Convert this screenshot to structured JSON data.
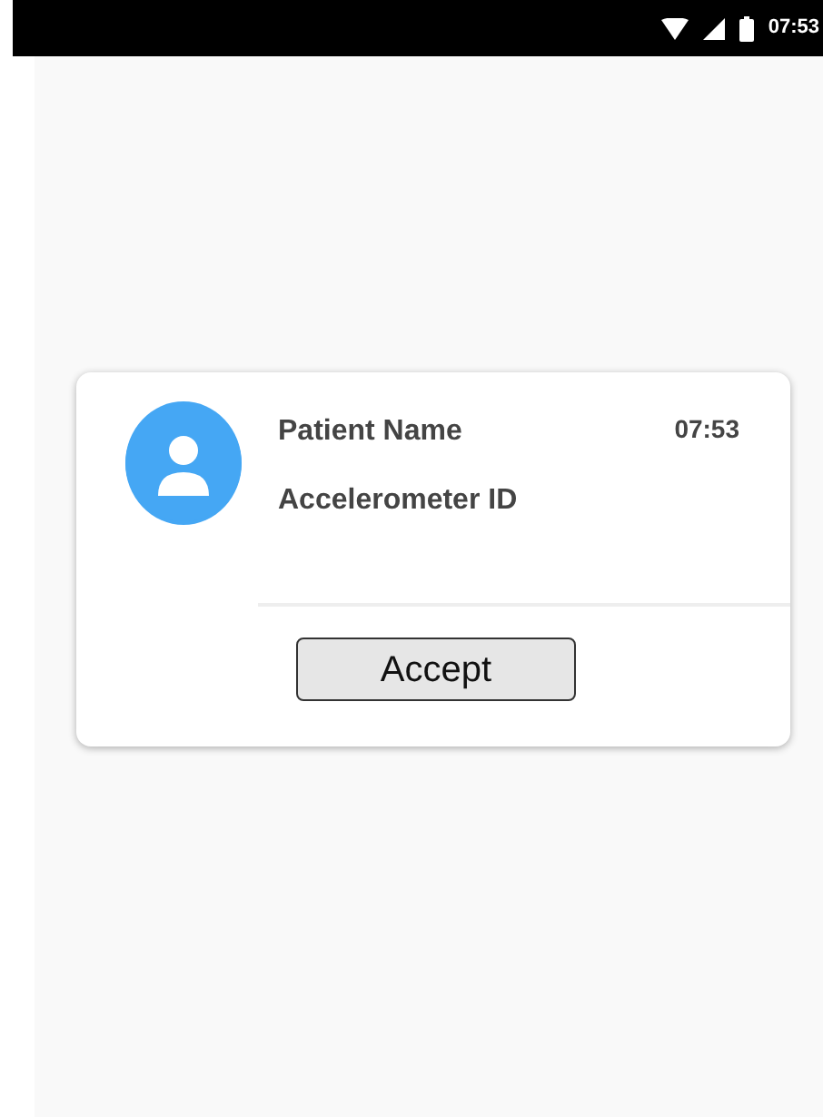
{
  "status_bar": {
    "time": "07:53"
  },
  "notification": {
    "title": "Patient Name",
    "time": "07:53",
    "subtitle": "Accelerometer ID",
    "button": "Accept"
  }
}
